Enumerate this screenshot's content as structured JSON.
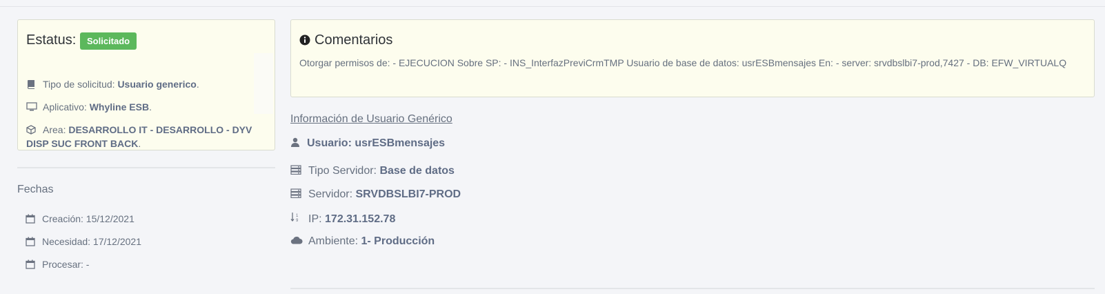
{
  "status": {
    "title": "Estatus:",
    "badge": "Solicitado",
    "badge_color": "#5cb85c",
    "tipo_label": "Tipo de solicitud:",
    "tipo_value": "Usuario generico",
    "app_label": "Aplicativo:",
    "app_value": "Whyline ESB",
    "area_label": "Area:",
    "area_value": "DESARROLLO IT - DESARROLLO - DYV DISP SUC FRONT BACK"
  },
  "comments": {
    "title": "Comentarios",
    "text": "Otorgar permisos de: - EJECUCION Sobre SP: - INS_InterfazPreviCrmTMP Usuario de base de datos: usrESBmensajes En: - server: srvdbslbi7-prod,7427 - DB: EFW_VIRTUALQ"
  },
  "fechas": {
    "title": "Fechas",
    "creacion": "Creación: 15/12/2021",
    "necesidad": "Necesidad: 17/12/2021",
    "procesar": "Procesar: -"
  },
  "info": {
    "link": "Información de Usuario Genérico",
    "usuario": "Usuario: usrESBmensajes",
    "tipo_servidor_label": "Tipo Servidor:",
    "tipo_servidor_value": "Base de datos",
    "servidor_label": "Servidor:",
    "servidor_value": "SRVDBSLBI7-PROD",
    "ip_label": "IP:",
    "ip_value": "172.31.152.78",
    "ambiente_label": "Ambiente:",
    "ambiente_value": "1- Producción"
  },
  "icons": {
    "book": "book-icon",
    "monitor": "monitor-icon",
    "cube": "cube-icon",
    "info": "info-icon",
    "calendar": "calendar-icon",
    "user": "user-icon",
    "server": "server-icon",
    "sort": "sort-numeric-icon",
    "cloud": "cloud-icon"
  }
}
